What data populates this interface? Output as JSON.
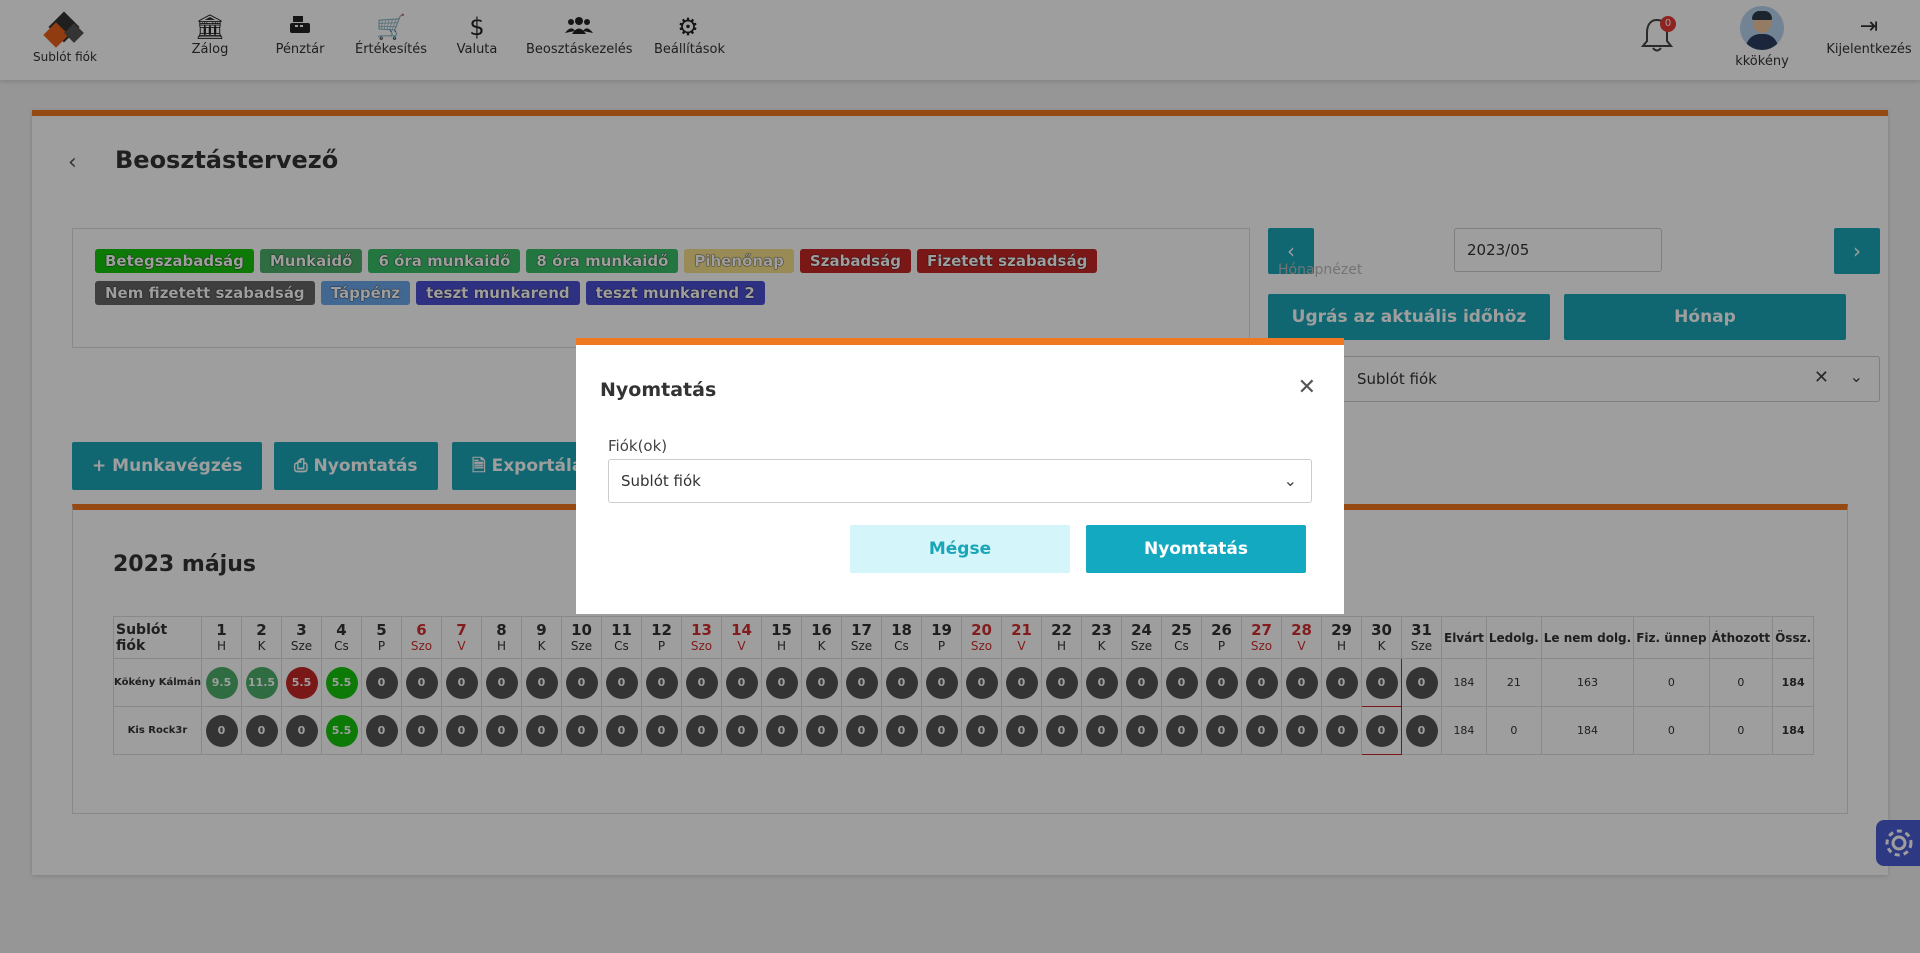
{
  "brand": {
    "label": "Sublót fiók"
  },
  "nav": [
    {
      "label": "Zálog",
      "icon": "bank-icon"
    },
    {
      "label": "Pénztár",
      "icon": "cash-register-icon"
    },
    {
      "label": "Értékesítés",
      "icon": "cart-icon"
    },
    {
      "label": "Valuta",
      "icon": "dollar-icon"
    },
    {
      "label": "Beosztáskezelés",
      "icon": "users-icon"
    },
    {
      "label": "Beállítások",
      "icon": "gear-icon"
    }
  ],
  "notifications": {
    "count": "0"
  },
  "user": {
    "name": "kkökény"
  },
  "logout": {
    "label": "Kijelentkezés"
  },
  "page": {
    "title": "Beosztástervező"
  },
  "legend": [
    {
      "label": "Betegszabadság",
      "color": "#16c60c"
    },
    {
      "label": "Munkaidő",
      "color": "#4caf6a"
    },
    {
      "label": "6 óra munkaidő",
      "color": "#3bbf6a"
    },
    {
      "label": "8 óra munkaidő",
      "color": "#3bbf6a"
    },
    {
      "label": "Pihenőnap",
      "color": "#f5e08a"
    },
    {
      "label": "Szabadság",
      "color": "#c62828"
    },
    {
      "label": "Fizetett szabadság",
      "color": "#c62828"
    },
    {
      "label": "Nem fizetett szabadság",
      "color": "#666666"
    },
    {
      "label": "Táppénz",
      "color": "#6ba6e8"
    },
    {
      "label": "teszt munkarend",
      "color": "#4b4fd1"
    },
    {
      "label": "teszt munkarend 2",
      "color": "#4b4fd1"
    }
  ],
  "date": {
    "value": "2023/05",
    "faded": "Hónapnézet"
  },
  "buttons": {
    "jump": "Ugrás az aktuális időhöz",
    "month": "Hónap",
    "work": "+ Munkavégzés",
    "print": "Nyomtatás",
    "export": "Exportálás"
  },
  "account_select": {
    "value": "Sublót fiók"
  },
  "schedule": {
    "title": "2023 május",
    "account_header": "Sublót fiók",
    "days": [
      {
        "n": "1",
        "d": "H"
      },
      {
        "n": "2",
        "d": "K"
      },
      {
        "n": "3",
        "d": "Sze"
      },
      {
        "n": "4",
        "d": "Cs"
      },
      {
        "n": "5",
        "d": "P"
      },
      {
        "n": "6",
        "d": "Szo",
        "weekend": true
      },
      {
        "n": "7",
        "d": "V",
        "weekend": true
      },
      {
        "n": "8",
        "d": "H"
      },
      {
        "n": "9",
        "d": "K"
      },
      {
        "n": "10",
        "d": "Sze"
      },
      {
        "n": "11",
        "d": "Cs"
      },
      {
        "n": "12",
        "d": "P"
      },
      {
        "n": "13",
        "d": "Szo",
        "weekend": true
      },
      {
        "n": "14",
        "d": "V",
        "weekend": true
      },
      {
        "n": "15",
        "d": "H"
      },
      {
        "n": "16",
        "d": "K"
      },
      {
        "n": "17",
        "d": "Sze"
      },
      {
        "n": "18",
        "d": "Cs"
      },
      {
        "n": "19",
        "d": "P"
      },
      {
        "n": "20",
        "d": "Szo",
        "weekend": true
      },
      {
        "n": "21",
        "d": "V",
        "weekend": true
      },
      {
        "n": "22",
        "d": "H"
      },
      {
        "n": "23",
        "d": "K"
      },
      {
        "n": "24",
        "d": "Sze"
      },
      {
        "n": "25",
        "d": "Cs"
      },
      {
        "n": "26",
        "d": "P"
      },
      {
        "n": "27",
        "d": "Szo",
        "weekend": true
      },
      {
        "n": "28",
        "d": "V",
        "weekend": true
      },
      {
        "n": "29",
        "d": "H"
      },
      {
        "n": "30",
        "d": "K",
        "today": true
      },
      {
        "n": "31",
        "d": "Sze"
      }
    ],
    "summary_headers": [
      "Elvárt",
      "Ledolg.",
      "Le nem dolg.",
      "Fiz. ünnep",
      "Áthozott",
      "Össz."
    ],
    "rows": [
      {
        "name": "Kökény Kálmán",
        "cells": [
          {
            "v": "9.5",
            "c": "#4caf6a"
          },
          {
            "v": "11.5",
            "c": "#4caf6a"
          },
          {
            "v": "5.5",
            "c": "#c62828"
          },
          {
            "v": "5.5",
            "c": "#16c60c"
          },
          {
            "v": "0"
          },
          {
            "v": "0"
          },
          {
            "v": "0"
          },
          {
            "v": "0"
          },
          {
            "v": "0"
          },
          {
            "v": "0"
          },
          {
            "v": "0"
          },
          {
            "v": "0"
          },
          {
            "v": "0"
          },
          {
            "v": "0"
          },
          {
            "v": "0"
          },
          {
            "v": "0"
          },
          {
            "v": "0"
          },
          {
            "v": "0"
          },
          {
            "v": "0"
          },
          {
            "v": "0"
          },
          {
            "v": "0"
          },
          {
            "v": "0"
          },
          {
            "v": "0"
          },
          {
            "v": "0"
          },
          {
            "v": "0"
          },
          {
            "v": "0"
          },
          {
            "v": "0"
          },
          {
            "v": "0"
          },
          {
            "v": "0"
          },
          {
            "v": "0"
          },
          {
            "v": "0"
          }
        ],
        "summary": [
          "184",
          "21",
          "163",
          "0",
          "0",
          "184"
        ]
      },
      {
        "name": "Kis Rock3r",
        "cells": [
          {
            "v": "0"
          },
          {
            "v": "0"
          },
          {
            "v": "0"
          },
          {
            "v": "5.5",
            "c": "#16c60c"
          },
          {
            "v": "0"
          },
          {
            "v": "0"
          },
          {
            "v": "0"
          },
          {
            "v": "0"
          },
          {
            "v": "0"
          },
          {
            "v": "0"
          },
          {
            "v": "0"
          },
          {
            "v": "0"
          },
          {
            "v": "0"
          },
          {
            "v": "0"
          },
          {
            "v": "0"
          },
          {
            "v": "0"
          },
          {
            "v": "0"
          },
          {
            "v": "0"
          },
          {
            "v": "0"
          },
          {
            "v": "0"
          },
          {
            "v": "0"
          },
          {
            "v": "0"
          },
          {
            "v": "0"
          },
          {
            "v": "0"
          },
          {
            "v": "0"
          },
          {
            "v": "0"
          },
          {
            "v": "0"
          },
          {
            "v": "0"
          },
          {
            "v": "0"
          },
          {
            "v": "0"
          },
          {
            "v": "0"
          }
        ],
        "summary": [
          "184",
          "0",
          "184",
          "0",
          "0",
          "184"
        ]
      }
    ]
  },
  "modal": {
    "title": "Nyomtatás",
    "field_label": "Fiók(ok)",
    "field_value": "Sublót fiók",
    "cancel": "Mégse",
    "confirm": "Nyomtatás"
  }
}
